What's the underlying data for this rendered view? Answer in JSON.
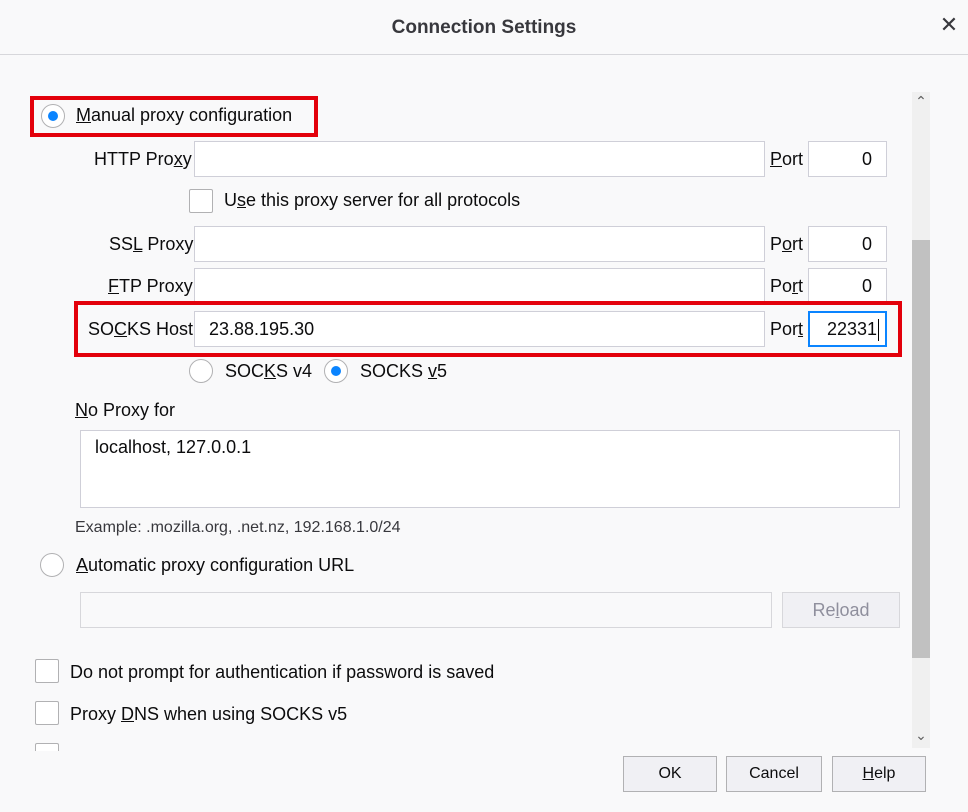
{
  "window": {
    "title": "Connection Settings",
    "close_glyph": "✕"
  },
  "manual": {
    "pre": "",
    "ul": "M",
    "post": "anual proxy configuration"
  },
  "http": {
    "label_pre": "HTTP Pro",
    "label_ul": "x",
    "label_post": "y",
    "value": "",
    "port_ul": "P",
    "port_post": "ort",
    "port_value": "0"
  },
  "all_protocols": {
    "pre": "U",
    "ul": "s",
    "post": "e this proxy server for all protocols"
  },
  "ssl": {
    "label_pre": "SS",
    "label_ul": "L",
    "label_post": " Proxy",
    "value": "",
    "port_pre": "P",
    "port_ul": "o",
    "port_post": "rt",
    "port_value": "0"
  },
  "ftp": {
    "label_pre": "",
    "label_ul": "F",
    "label_post": "TP Proxy",
    "value": "",
    "port_pre": "Po",
    "port_ul": "r",
    "port_post": "t",
    "port_value": "0"
  },
  "socks": {
    "label_pre": "SO",
    "label_ul": "C",
    "label_post": "KS Host",
    "value": "23.88.195.30",
    "port_pre": "Por",
    "port_ul": "t",
    "port_value": "22331",
    "v4_pre": "SOC",
    "v4_ul": "K",
    "v4_post": "S v4",
    "v5_pre": "SOCKS ",
    "v5_ul": "v",
    "v5_post": "5"
  },
  "no_proxy": {
    "label_ul": "N",
    "label_post": "o Proxy for",
    "value": "localhost, 127.0.0.1",
    "example": "Example: .mozilla.org, .net.nz, 192.168.1.0/24"
  },
  "auto": {
    "ul": "A",
    "post": "utomatic proxy configuration URL",
    "url_value": "",
    "reload_pre": "Re",
    "reload_ul": "l",
    "reload_post": "oad"
  },
  "no_prompt": {
    "pre": "Do not prompt for authentication if password is saved"
  },
  "proxy_dns": {
    "pre": "Proxy ",
    "ul": "D",
    "post": "NS when using SOCKS v5"
  },
  "buttons": {
    "ok": "OK",
    "cancel": "Cancel",
    "help_ul": "H",
    "help_post": "elp"
  },
  "scrollbar": {
    "up": "⌃",
    "down": "⌄"
  },
  "colors": {
    "highlight": "#e3000b",
    "accent": "#0a84ff"
  }
}
